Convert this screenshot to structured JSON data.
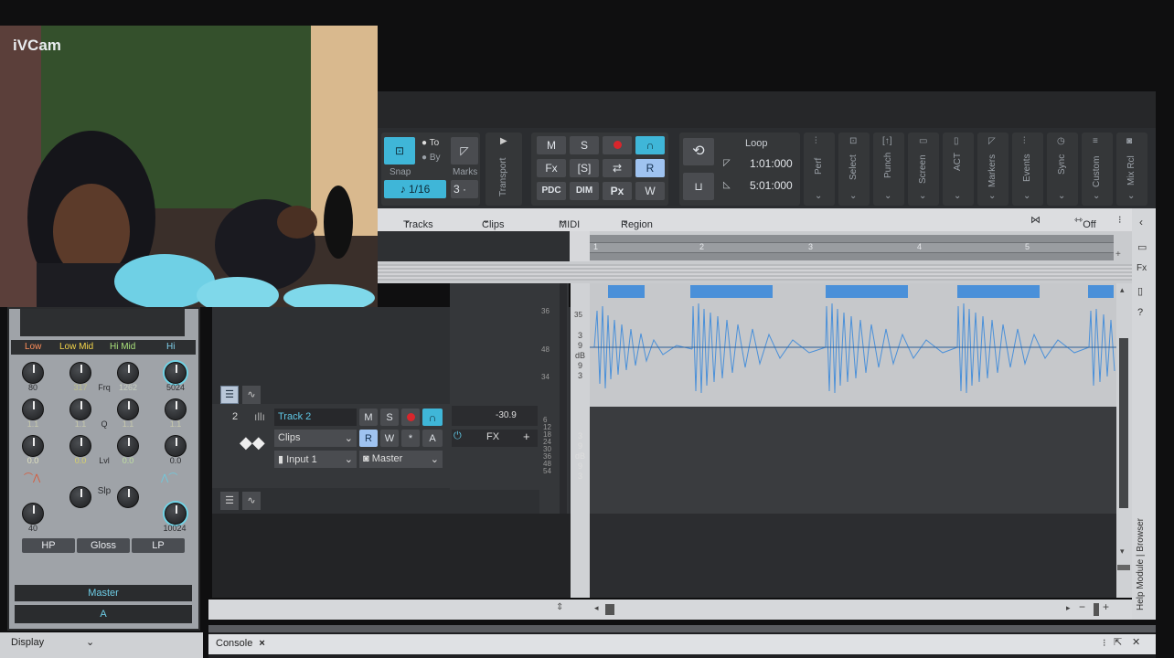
{
  "webcam": {
    "label": "iVCam"
  },
  "colors": {
    "accent": "#3fb6d8",
    "waveform": "#4a90d9",
    "record": "#d8262c"
  },
  "control_bar": {
    "snap": {
      "label": "Snap",
      "value": "1/16",
      "to": "To",
      "by": "By"
    },
    "marks": {
      "label": "Marks",
      "value": "3"
    },
    "transport_label": "Transport",
    "mix_buttons_row1": [
      "M",
      "S",
      "",
      ""
    ],
    "mix_buttons_row2": [
      "Fx",
      "[S]",
      "",
      "R"
    ],
    "mix_buttons_row3": [
      "PDC",
      "DIM",
      "Px",
      "W"
    ],
    "loop": {
      "label": "Loop",
      "start": "1:01:000",
      "end": "5:01:000"
    },
    "modules": [
      "Perf",
      "Select",
      "Punch",
      "Screen",
      "ACT",
      "Markers",
      "Events",
      "Sync",
      "Custom",
      "Mix Rcl"
    ]
  },
  "menu": {
    "items": [
      "Tracks",
      "Clips",
      "MIDI",
      "Region FX"
    ],
    "off_label": "Off"
  },
  "ruler": {
    "ticks": [
      "1",
      "2",
      "3",
      "4",
      "5"
    ]
  },
  "clip_db": [
    "35",
    "3",
    "9",
    "dB",
    "9",
    "3"
  ],
  "meter_db_top": [
    "36",
    "48",
    "34"
  ],
  "track": {
    "number": "2",
    "name": "Track 2",
    "buttons_row1": [
      "M",
      "S",
      "",
      ""
    ],
    "buttons_row2": [
      "R",
      "W",
      "*",
      "A"
    ],
    "clips_select": "Clips",
    "input_select": "Input 1",
    "output_select": "Master",
    "volume": "-30.9",
    "fx_label": "FX"
  },
  "meter_db_bottom": [
    "6",
    "12",
    "18",
    "24",
    "30",
    "36",
    "48",
    "54"
  ],
  "track_db": [
    "3",
    "9",
    "dB",
    "9",
    "3"
  ],
  "eq": {
    "bands": [
      "Low",
      "Low Mid",
      "Hi Mid",
      "Hi"
    ],
    "freq": [
      "80",
      "317",
      "1262",
      "5024"
    ],
    "freq_label": "Frq",
    "q_values": [
      "1.1",
      "1.1",
      "1.1",
      "1.1"
    ],
    "q_label": "Q",
    "level_values": [
      "0.0",
      "0.0",
      "0.0",
      "0.0"
    ],
    "level_label": "Lvl",
    "slope_label": "Slp",
    "hp_value": "40",
    "lp_value": "10024",
    "buttons": [
      "HP",
      "Gloss",
      "LP"
    ],
    "master_label": "Master",
    "a_label": "A"
  },
  "display_select": "Display",
  "console_tab": {
    "label": "Console",
    "close": "×"
  },
  "side_labels": "Help Module | Browser"
}
